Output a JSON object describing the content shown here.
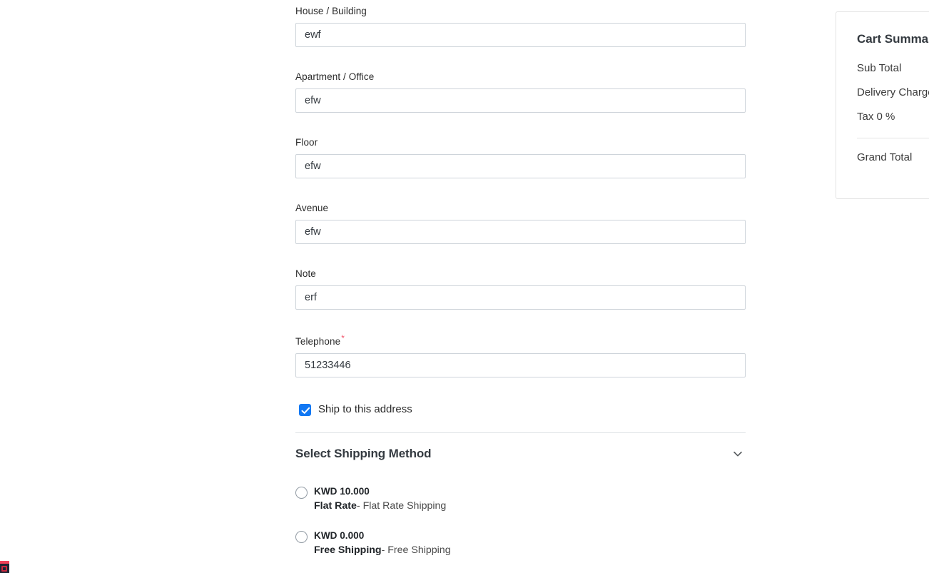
{
  "form": {
    "fields": [
      {
        "label": "House / Building",
        "value": "ewf",
        "required": false,
        "placeholder": ""
      },
      {
        "label": "Apartment / Office",
        "value": "efw",
        "required": false,
        "placeholder": ""
      },
      {
        "label": "Floor",
        "value": "efw",
        "required": false,
        "placeholder": ""
      },
      {
        "label": "Avenue",
        "value": "efw",
        "required": false,
        "placeholder": ""
      },
      {
        "label": "Note",
        "value": "erf",
        "required": false,
        "placeholder": ""
      },
      {
        "label": "Telephone",
        "value": "51233446",
        "required": true,
        "placeholder": ""
      }
    ],
    "required_marker": "*",
    "ship_to_address": {
      "label": "Ship to this address",
      "checked": true
    }
  },
  "shipping": {
    "section_title": "Select Shipping Method",
    "toggle_icon": "chevron-down-icon",
    "options": [
      {
        "price": "KWD 10.000",
        "carrier": "Flat Rate",
        "description": "- Flat Rate Shipping",
        "selected": false
      },
      {
        "price": "KWD 0.000",
        "carrier": "Free Shipping",
        "description": "- Free Shipping",
        "selected": false
      }
    ]
  },
  "cart_summary": {
    "title": "Cart Summary",
    "rows": [
      {
        "label": "Sub Total"
      },
      {
        "label": "Delivery Charge"
      },
      {
        "label": "Tax 0 %"
      }
    ],
    "grand_total_label": "Grand Total"
  },
  "colors": {
    "checkbox_accent": "#1278f3",
    "required_star": "#f1556c",
    "border": "#ced4da",
    "divider": "#dee2e6",
    "text": "#212529",
    "widget_bar": "#f0435a",
    "widget_bg": "#1d2433"
  }
}
